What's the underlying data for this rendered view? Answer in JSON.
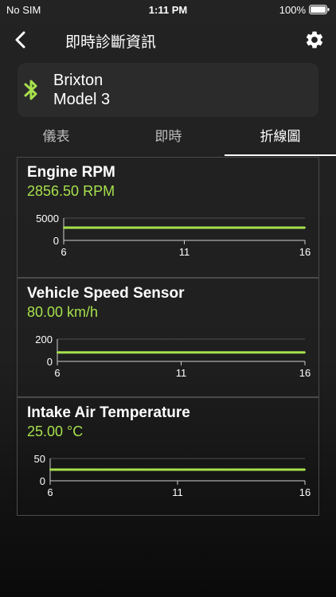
{
  "status": {
    "carrier": "No SIM",
    "time": "1:11 PM",
    "battery": "100%"
  },
  "nav": {
    "title": "即時診斷資訊",
    "back_icon": "chevron-left-icon",
    "settings_icon": "gear-icon"
  },
  "device": {
    "make": "Brixton",
    "model": "Model 3",
    "icon": "bluetooth-icon",
    "accent": "#a6e04c"
  },
  "tabs": [
    {
      "label": "儀表",
      "active": false
    },
    {
      "label": "即時",
      "active": false
    },
    {
      "label": "折線圖",
      "active": true
    }
  ],
  "chart_data": [
    {
      "type": "line",
      "title": "Engine RPM",
      "current_value": "2856.50 RPM",
      "x": [
        6,
        7,
        8,
        9,
        10,
        11,
        12,
        13,
        14,
        15,
        16
      ],
      "series": [
        {
          "values": [
            2856.5,
            2856.5,
            2856.5,
            2856.5,
            2856.5,
            2856.5,
            2856.5,
            2856.5,
            2856.5,
            2856.5,
            2856.5
          ]
        }
      ],
      "xticks": [
        "6",
        "11",
        "16"
      ],
      "yticks": [
        "0",
        "5000"
      ],
      "ylim": [
        0,
        5000
      ],
      "xlim": [
        6,
        16
      ],
      "color": "#a6e04c"
    },
    {
      "type": "line",
      "title": "Vehicle Speed Sensor",
      "current_value": "80.00 km/h",
      "x": [
        6,
        7,
        8,
        9,
        10,
        11,
        12,
        13,
        14,
        15,
        16
      ],
      "series": [
        {
          "values": [
            80,
            80,
            80,
            80,
            80,
            80,
            80,
            80,
            80,
            80,
            80
          ]
        }
      ],
      "xticks": [
        "6",
        "11",
        "16"
      ],
      "yticks": [
        "0",
        "200"
      ],
      "ylim": [
        0,
        200
      ],
      "xlim": [
        6,
        16
      ],
      "color": "#a6e04c"
    },
    {
      "type": "line",
      "title": "Intake Air Temperature",
      "current_value": "25.00 °C",
      "x": [
        6,
        7,
        8,
        9,
        10,
        11,
        12,
        13,
        14,
        15,
        16
      ],
      "series": [
        {
          "values": [
            25,
            25,
            25,
            25,
            25,
            25,
            25,
            25,
            25,
            25,
            25
          ]
        }
      ],
      "xticks": [
        "6",
        "11",
        "16"
      ],
      "yticks": [
        "0",
        "50"
      ],
      "ylim": [
        0,
        50
      ],
      "xlim": [
        6,
        16
      ],
      "color": "#a6e04c"
    }
  ]
}
